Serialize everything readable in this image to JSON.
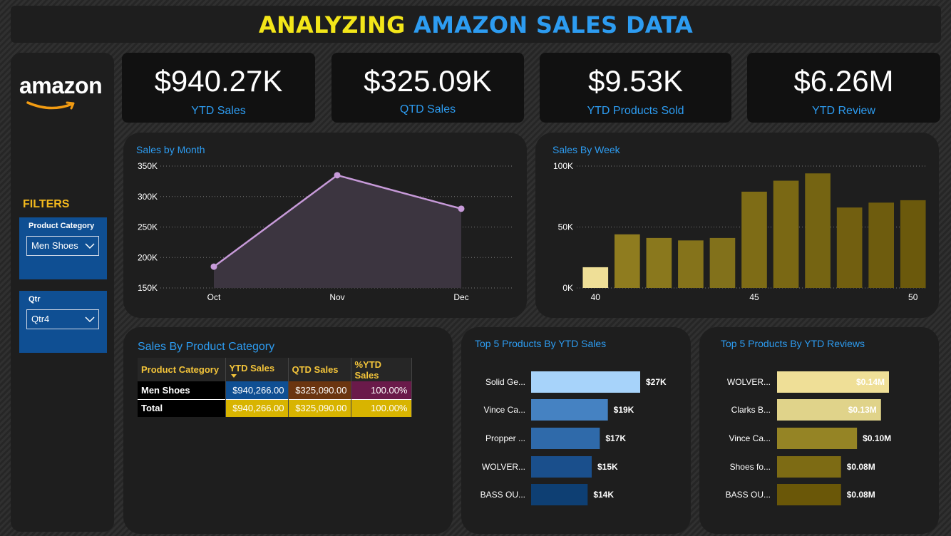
{
  "title": {
    "part1": "ANALYZING",
    "part2": "AMAZON SALES DATA"
  },
  "colors": {
    "title_yellow": "#f3e619",
    "accent_blue": "#2d9cf1",
    "filter_blue": "#0f4f93",
    "amazon_orange": "#f39c12"
  },
  "sidebar": {
    "logo_text": "amazon",
    "filters_label": "FILTERS",
    "filters": [
      {
        "label": "Product Category",
        "value": "Men Shoes",
        "icon": "chevron-down-icon"
      },
      {
        "label": "Qtr",
        "value": "Qtr4",
        "icon": "chevron-down-icon"
      }
    ]
  },
  "kpis": [
    {
      "value": "$940.27K",
      "label": "YTD Sales"
    },
    {
      "value": "$325.09K",
      "label": "QTD Sales"
    },
    {
      "value": "$9.53K",
      "label": "YTD Products Sold"
    },
    {
      "value": "$6.26M",
      "label": "YTD Review"
    }
  ],
  "chart_data": [
    {
      "id": "sales_by_month",
      "type": "area",
      "title": "Sales by Month",
      "categories": [
        "Oct",
        "Nov",
        "Dec"
      ],
      "values": [
        185000,
        335000,
        280000
      ],
      "ylim": [
        150000,
        350000
      ],
      "yticks": [
        "150K",
        "200K",
        "250K",
        "300K",
        "350K"
      ],
      "color": "#c79ad9",
      "grid": true
    },
    {
      "id": "sales_by_week",
      "type": "bar",
      "title": "Sales By Week",
      "x": [
        40,
        41,
        42,
        43,
        44,
        45,
        46,
        47,
        48,
        49,
        50
      ],
      "values": [
        17000,
        44000,
        41000,
        39000,
        41000,
        79000,
        88000,
        94000,
        66000,
        70000,
        72000
      ],
      "ylim": [
        0,
        100000
      ],
      "yticks": [
        "0K",
        "50K",
        "100K"
      ],
      "xticks": [
        "40",
        "45",
        "50"
      ],
      "highlight_color": "#efdf97",
      "colors": [
        "#efdf97",
        "#8f7c1f",
        "#8a781d",
        "#85731b",
        "#82711b",
        "#7e6c16",
        "#7a6814",
        "#756412",
        "#725f10",
        "#6e5c0e",
        "#6b590c"
      ],
      "grid": true
    },
    {
      "id": "top5_ytd_sales",
      "type": "bar",
      "orientation": "horizontal",
      "title": "Top 5 Products By YTD Sales",
      "categories": [
        "Solid Ge...",
        "Vince Ca...",
        "Propper ...",
        "WOLVER...",
        "BASS OU..."
      ],
      "values": [
        27,
        19,
        17,
        15,
        14
      ],
      "value_labels": [
        "$27K",
        "$19K",
        "$17K",
        "$15K",
        "$14K"
      ],
      "unit": "K",
      "colors": [
        "#a7d3fa",
        "#4582c2",
        "#2f6aaa",
        "#1a4f8c",
        "#0e3f73"
      ]
    },
    {
      "id": "top5_ytd_reviews",
      "type": "bar",
      "orientation": "horizontal",
      "title": "Top 5 Products By YTD Reviews",
      "categories": [
        "WOLVER...",
        "Clarks B...",
        "Vince Ca...",
        "Shoes fo...",
        "BASS OU..."
      ],
      "values": [
        0.14,
        0.13,
        0.1,
        0.08,
        0.08
      ],
      "value_labels": [
        "$0.14M",
        "$0.13M",
        "$0.10M",
        "$0.08M",
        "$0.08M"
      ],
      "unit": "M",
      "colors": [
        "#efdf97",
        "#e0d38a",
        "#958425",
        "#7d6b14",
        "#6a5708"
      ]
    }
  ],
  "category_table": {
    "title": "Sales By Product Category",
    "columns": [
      "Product Category",
      "YTD Sales",
      "QTD Sales",
      "%YTD Sales"
    ],
    "sort_column": "YTD Sales",
    "rows": [
      {
        "cells": [
          "Men Shoes",
          "$940,266.00",
          "$325,090.00",
          "100.00%"
        ]
      }
    ],
    "total": {
      "cells": [
        "Total",
        "$940,266.00",
        "$325,090.00",
        "100.00%"
      ]
    },
    "cell_colors": {
      "row": [
        "#000000",
        "#0f4f93",
        "#6b3510",
        "#6a1a4a"
      ],
      "total": [
        "#000000",
        "#d8b400",
        "#d8b400",
        "#d8b400"
      ]
    }
  }
}
